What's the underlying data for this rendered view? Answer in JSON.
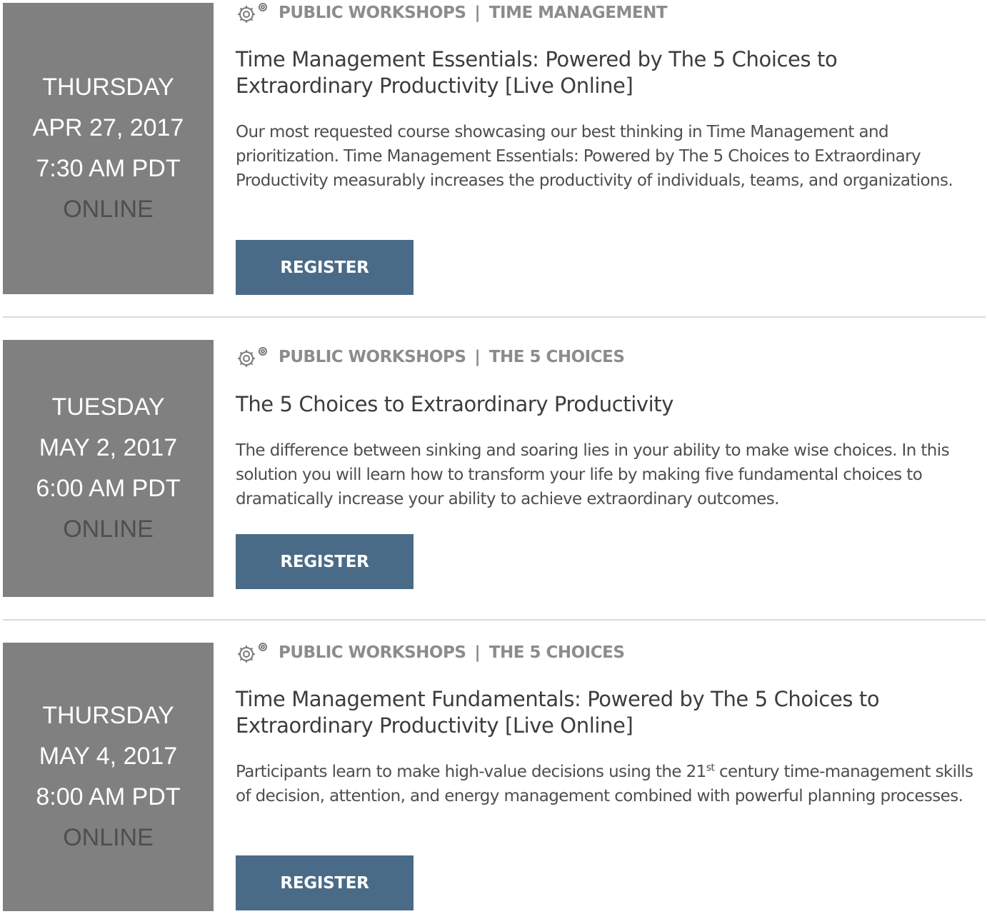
{
  "events": [
    {
      "date": {
        "weekday": "THURSDAY",
        "date": "APR 27, 2017",
        "time": "7:30 AM PDT",
        "location": "ONLINE"
      },
      "category": {
        "icon": "gears-icon",
        "primary": "PUBLIC WORKSHOPS",
        "separator": "|",
        "secondary": "TIME MANAGEMENT"
      },
      "title": "Time Management Essentials: Powered by The 5 Choices to Extraordinary Productivity [Live Online]",
      "description": "Our most requested course showcasing our best thinking in Time Management and prioritization. Time Management Essentials: Powered by The 5 Choices to Extraordinary Productivity measurably increases the productivity of individuals, teams, and organizations.",
      "register_label": "REGISTER"
    },
    {
      "date": {
        "weekday": "TUESDAY",
        "date": "MAY 2, 2017",
        "time": "6:00 AM PDT",
        "location": "ONLINE"
      },
      "category": {
        "icon": "gears-icon",
        "primary": "PUBLIC WORKSHOPS",
        "separator": "|",
        "secondary": "THE 5 CHOICES"
      },
      "title": "The 5 Choices to Extraordinary Productivity",
      "description": "The difference between sinking and soaring lies in your ability to make wise choices. In this solution you will learn how to transform your life by making five fundamental choices to dramatically increase your ability to achieve extraordinary outcomes.",
      "register_label": "REGISTER"
    },
    {
      "date": {
        "weekday": "THURSDAY",
        "date": "MAY 4, 2017",
        "time": "8:00 AM PDT",
        "location": "ONLINE"
      },
      "category": {
        "icon": "gears-icon",
        "primary": "PUBLIC WORKSHOPS",
        "separator": "|",
        "secondary": "THE 5 CHOICES"
      },
      "title": "Time Management Fundamentals: Powered by The 5 Choices to Extraordinary Productivity [Live Online]",
      "description_before": "Participants learn to make high-value decisions using the 21",
      "description_sup": "st",
      "description_after": " century time-management skills of decision, attention, and energy management combined with powerful planning processes.",
      "register_label": "REGISTER"
    }
  ],
  "colors": {
    "date_box_bg": "#808080",
    "date_text": "#ffffff",
    "location_text": "#4e4e4e",
    "category_text": "#8c8c8c",
    "register_bg": "#4a6b87",
    "divider": "#d9d9d9"
  }
}
